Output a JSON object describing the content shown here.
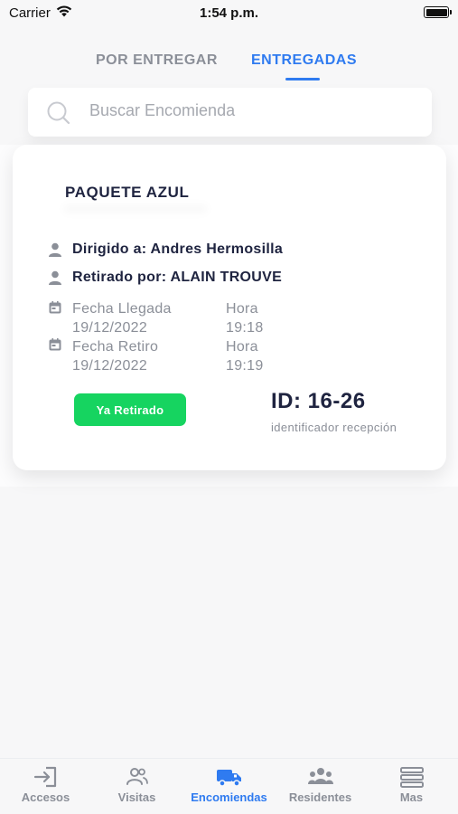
{
  "status_bar": {
    "carrier": "Carrier",
    "time": "1:54 p.m."
  },
  "tabs": [
    {
      "label": "POR ENTREGAR",
      "active": false
    },
    {
      "label": "ENTREGADAS",
      "active": true
    }
  ],
  "search": {
    "placeholder": "Buscar Encomienda",
    "icon": "search-icon"
  },
  "package": {
    "title": "PAQUETE AZUL",
    "directed_to": "Dirigido a: Andres Hermosilla",
    "picked_by": "Retirado por: ALAIN TROUVE",
    "arrival_label": "Fecha Llegada",
    "arrival_date": "19/12/2022",
    "arrival_time_label": "Hora",
    "arrival_time": "19:18",
    "pickup_label": "Fecha Retiro",
    "pickup_date": "19/12/2022",
    "pickup_time_label": "Hora",
    "pickup_time": "19:19",
    "status_badge": "Ya Retirado",
    "id": "ID: 16-26",
    "id_caption": "identificador recepción"
  },
  "bottom_nav": [
    {
      "label": "Accesos",
      "icon": "login-icon",
      "active": false
    },
    {
      "label": "Visitas",
      "icon": "users-icon",
      "active": false
    },
    {
      "label": "Encomiendas",
      "icon": "truck-icon",
      "active": true
    },
    {
      "label": "Residentes",
      "icon": "group-icon",
      "active": false
    },
    {
      "label": "Mas",
      "icon": "menu-icon",
      "active": false
    }
  ],
  "colors": {
    "accent": "#2f7bf0",
    "success": "#16d460",
    "muted": "#8b8f98",
    "title": "#1f2440"
  }
}
